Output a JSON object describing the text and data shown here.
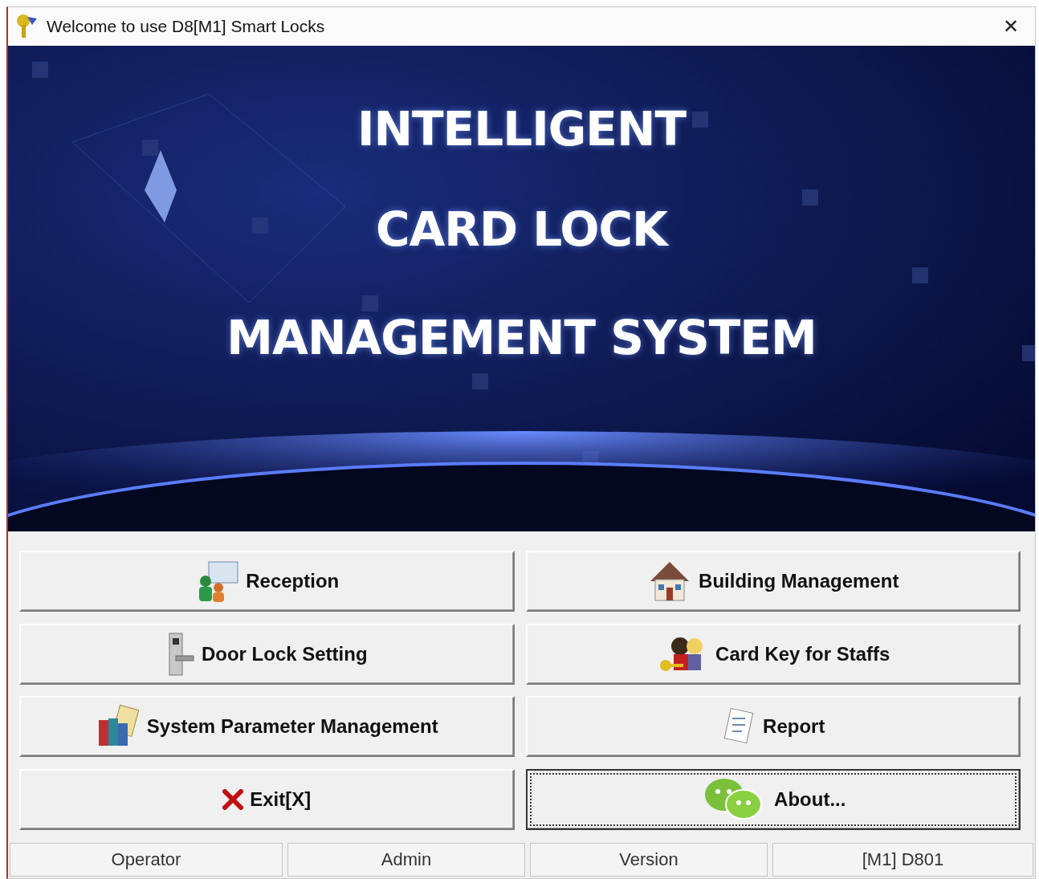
{
  "window": {
    "title": "Welcome to use D8[M1] Smart Locks",
    "close": "✕"
  },
  "banner": {
    "kind": "picture",
    "title_lines": [
      "INTELLIGENT",
      "CARD LOCK",
      "MANAGEMENT SYSTEM"
    ]
  },
  "buttons": [
    {
      "label": "Reception",
      "focused": false
    },
    {
      "label": "Building Management",
      "focused": false
    },
    {
      "label": "Door Lock Setting",
      "focused": false
    },
    {
      "label": "Card Key for Staffs",
      "focused": false
    },
    {
      "label": "System Parameter Management",
      "focused": false
    },
    {
      "label": "Report",
      "focused": false
    },
    {
      "label": "Exit[X]",
      "focused": false
    },
    {
      "label": "About...",
      "focused": true
    }
  ],
  "status_bar": [
    "Operator",
    "Admin",
    "Version",
    "[M1] D801"
  ]
}
